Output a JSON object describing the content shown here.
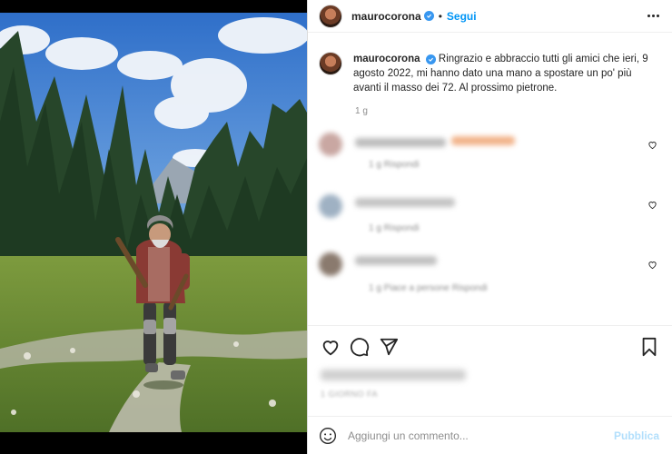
{
  "post": {
    "username": "maurocorona",
    "follow_label": "Segui",
    "separator": "•",
    "verified": true
  },
  "caption": {
    "username": "maurocorona",
    "text": "Ringrazio e abbraccio tutti gli amici che ieri, 9 agosto 2022, mi hanno dato una mano a spostare un po' più avanti il masso dei 72. Al prossimo pietrone.",
    "time": "1 g"
  },
  "comments": [
    {
      "meta": "1 g   Rispondi"
    },
    {
      "meta": "1 g   Rispondi"
    },
    {
      "meta": "1 g   Piace a persone   Rispondi"
    }
  ],
  "actions": {
    "date": "1 GIORNO FA"
  },
  "add_comment": {
    "placeholder": "Aggiungi un commento...",
    "publish_label": "Pubblica"
  },
  "colors": {
    "accent": "#0095f6",
    "publish_disabled": "#b2dffc",
    "verified": "#3897f0"
  },
  "icons": [
    "more-icon",
    "verified-icon",
    "heart-icon",
    "comment-icon",
    "share-icon",
    "bookmark-icon",
    "emoji-icon"
  ]
}
